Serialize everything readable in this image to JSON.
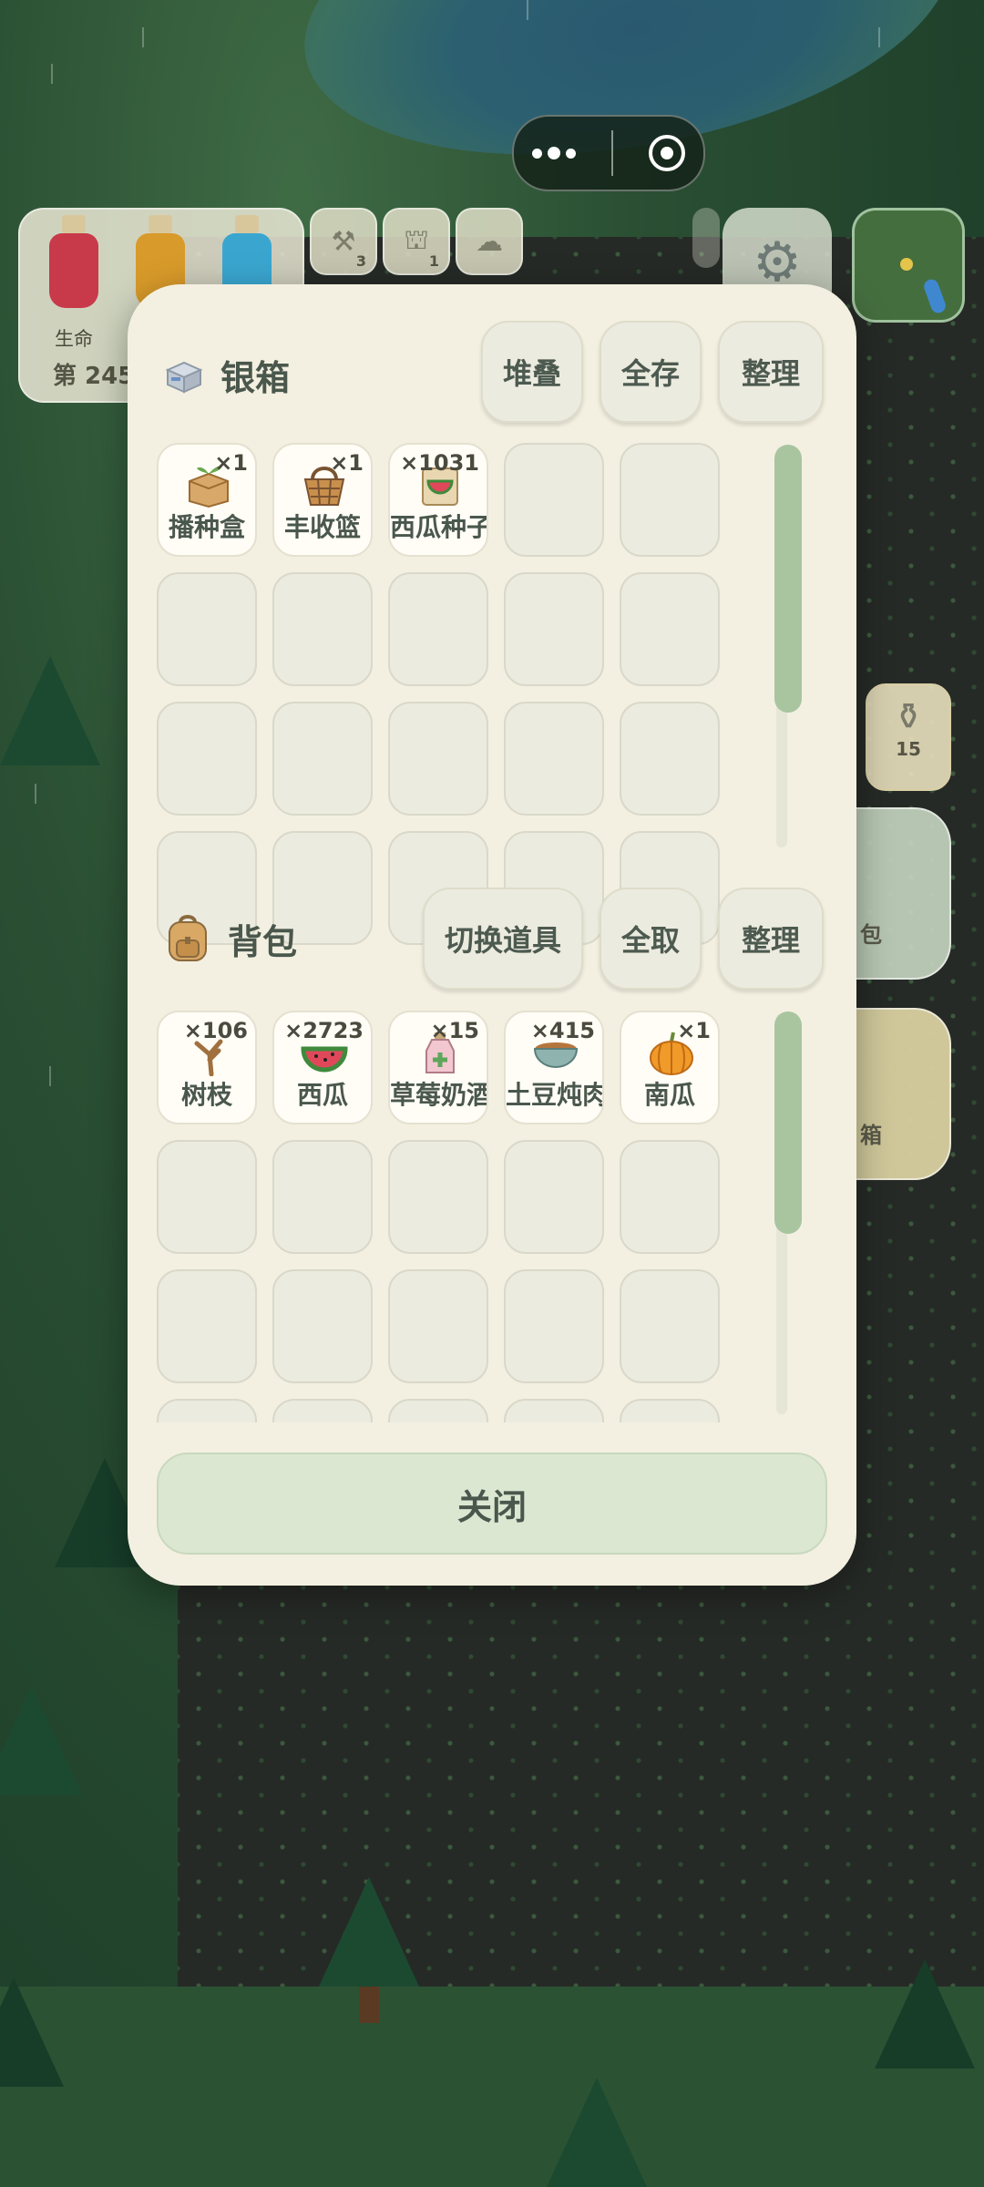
{
  "hud": {
    "stat_label": "生命",
    "day_label": "第 245",
    "shortcut_counts": [
      "3",
      "1"
    ],
    "potion_count": "15",
    "side_buttons": {
      "backpack": "包",
      "chest": "箱"
    },
    "colors": {
      "life": "#c83a4a",
      "hunger": "#d89a2a",
      "water": "#3aa6d0"
    }
  },
  "chest": {
    "title": "银箱",
    "buttons": [
      "堆叠",
      "全存",
      "整理"
    ],
    "items": [
      {
        "name": "播种盒",
        "qty": "×1",
        "icon": "seed-box-icon"
      },
      {
        "name": "丰收篮",
        "qty": "×1",
        "icon": "basket-icon"
      },
      {
        "name": "西瓜种子",
        "qty": "×1031",
        "icon": "watermelon-seed-pack-icon"
      }
    ]
  },
  "backpack": {
    "title": "背包",
    "buttons": [
      "切换道具",
      "全取",
      "整理"
    ],
    "items": [
      {
        "name": "树枝",
        "qty": "×106",
        "icon": "branch-icon"
      },
      {
        "name": "西瓜",
        "qty": "×2723",
        "icon": "watermelon-icon"
      },
      {
        "name": "草莓奶酒",
        "qty": "×15",
        "icon": "potion-bottle-icon"
      },
      {
        "name": "土豆炖肉",
        "qty": "×415",
        "icon": "stew-bowl-icon"
      },
      {
        "name": "南瓜",
        "qty": "×1",
        "icon": "pumpkin-icon"
      }
    ]
  },
  "close_label": "关闭"
}
